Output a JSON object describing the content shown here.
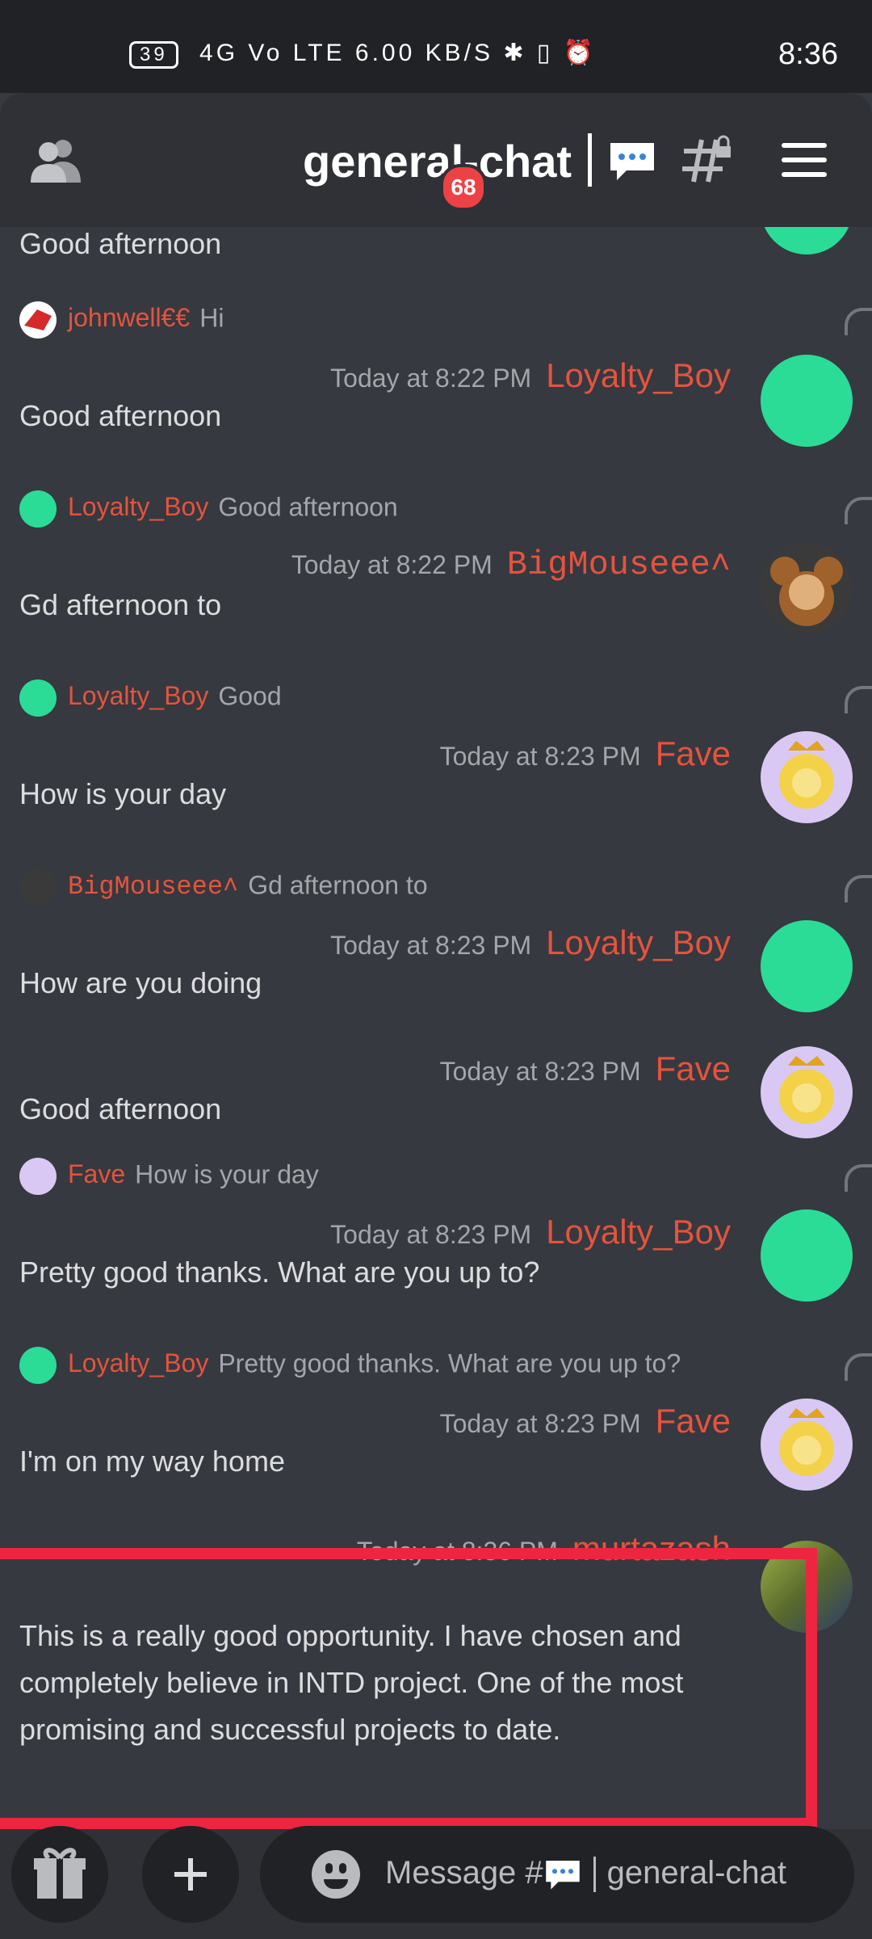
{
  "status_bar": {
    "battery": "39",
    "indicators": "4G  Vo LTE  6.00 KB/S  ✱  ▯  ⏰",
    "time": "8:36"
  },
  "header": {
    "channel_title": "general-chat",
    "unread_badge": "68",
    "icons": [
      "people-icon",
      "chat-bubble-icon",
      "locked-thread-icon",
      "hamburger-menu-icon"
    ]
  },
  "messages": [
    {
      "type": "text",
      "text": "Good afternoon"
    },
    {
      "type": "reply",
      "author": "johnwell€€",
      "text": "Hi"
    },
    {
      "type": "message",
      "timestamp": "Today at 8:22 PM",
      "author": "Loyalty_Boy",
      "text": "Good afternoon"
    },
    {
      "type": "reply",
      "author": "Loyalty_Boy",
      "text": "Good afternoon"
    },
    {
      "type": "message",
      "timestamp": "Today at 8:22 PM",
      "author": "BigMouseee˄",
      "text": "Gd afternoon to"
    },
    {
      "type": "reply",
      "author": "Loyalty_Boy",
      "text": "Good"
    },
    {
      "type": "message",
      "timestamp": "Today at 8:23 PM",
      "author": "Fave",
      "text": "How is your day"
    },
    {
      "type": "reply",
      "author": "BigMouseee˄",
      "text": "Gd afternoon to"
    },
    {
      "type": "message",
      "timestamp": "Today at 8:23 PM",
      "author": "Loyalty_Boy",
      "text": "How are you doing"
    },
    {
      "type": "message",
      "timestamp": "Today at 8:23 PM",
      "author": "Fave",
      "text": "Good afternoon"
    },
    {
      "type": "reply",
      "author": "Fave",
      "text": "How is your day"
    },
    {
      "type": "message",
      "timestamp": "Today at 8:23 PM",
      "author": "Loyalty_Boy",
      "text": "Pretty good thanks. What are you up to?"
    },
    {
      "type": "reply",
      "author": "Loyalty_Boy",
      "text": "Pretty good thanks. What are you up to?"
    },
    {
      "type": "message",
      "timestamp": "Today at 8:23 PM",
      "author": "Fave",
      "text": "I'm on my way home"
    },
    {
      "type": "message",
      "timestamp": "Today at 8:36 PM",
      "author": "murtazash",
      "text": "This is a really good opportunity. I have chosen and completely believe in INTD project. One of the most promising and successful projects to date."
    }
  ],
  "bottom_bar": {
    "placeholder_prefix": "Message #",
    "placeholder_channel": "general-chat",
    "icons": [
      "gift-icon",
      "plus-icon",
      "emoji-icon"
    ]
  },
  "colors": {
    "background": "#36393f",
    "header": "#2f3136",
    "author": "#e5533e",
    "highlight": "#ed2540"
  }
}
